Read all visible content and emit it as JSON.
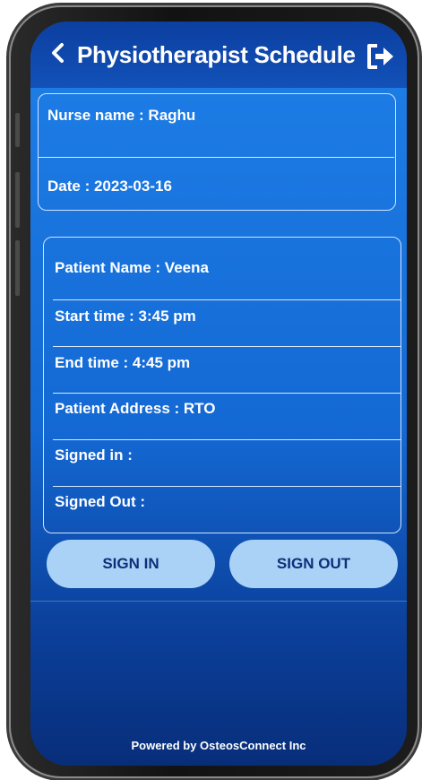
{
  "header": {
    "title": "Physiotherapist Schedule",
    "back_icon": "chevron-left-icon",
    "logout_icon": "logout-icon"
  },
  "nurse_info": {
    "nurse_name": "Nurse name : Raghu",
    "date": "Date : 2023-03-16"
  },
  "patient_info": {
    "patient_name": "Patient Name : Veena",
    "start_time": "Start time : 3:45 pm",
    "end_time": "End time : 4:45 pm",
    "patient_address": "Patient Address : RTO",
    "signed_in": "Signed in :",
    "signed_out": "Signed Out :"
  },
  "actions": {
    "sign_in_label": "SIGN IN",
    "sign_out_label": "SIGN OUT"
  },
  "footer": {
    "powered_by": "Powered by OsteosConnect Inc"
  },
  "colors": {
    "header_bg": "#0c3fa0",
    "screen_bg": "#1f7fe8",
    "button_bg": "#a9d2f6",
    "button_text": "#0e2f7a"
  }
}
